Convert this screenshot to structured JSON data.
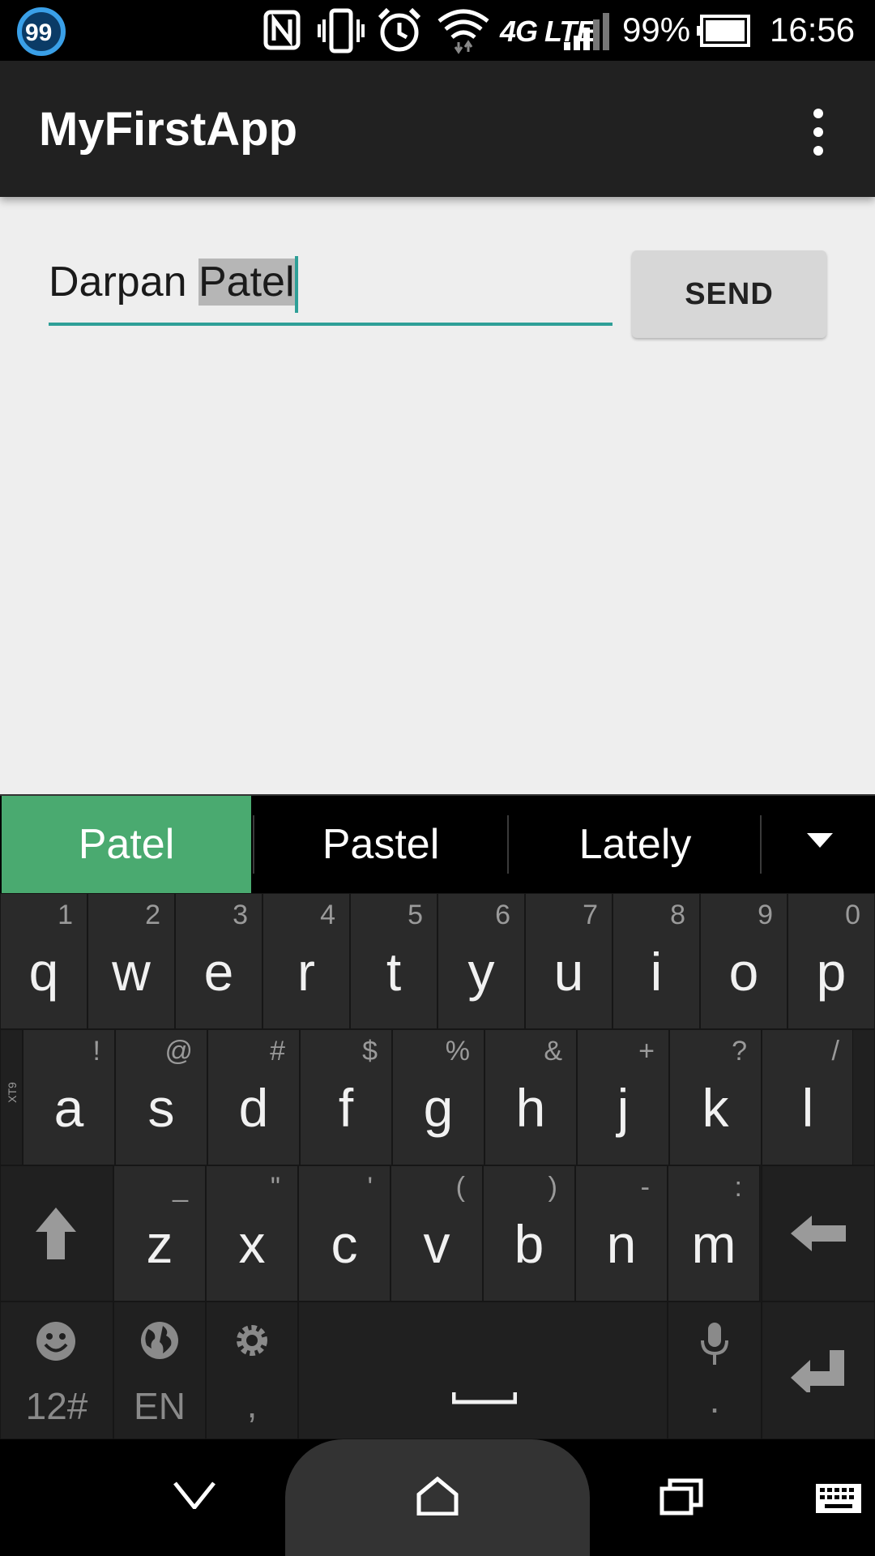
{
  "status_bar": {
    "badge": "99",
    "network": "4G LTE",
    "battery": "99%",
    "time": "16:56"
  },
  "app": {
    "title": "MyFirstApp"
  },
  "editor": {
    "text_before": "Darpan ",
    "text_selected": "Patel",
    "send_label": "SEND"
  },
  "suggestions": {
    "items": [
      "Patel",
      "Pastel",
      "Lately"
    ],
    "active_index": 0
  },
  "keyboard": {
    "row1": [
      {
        "key": "q",
        "hint": "1"
      },
      {
        "key": "w",
        "hint": "2"
      },
      {
        "key": "e",
        "hint": "3"
      },
      {
        "key": "r",
        "hint": "4"
      },
      {
        "key": "t",
        "hint": "5"
      },
      {
        "key": "y",
        "hint": "6"
      },
      {
        "key": "u",
        "hint": "7"
      },
      {
        "key": "i",
        "hint": "8"
      },
      {
        "key": "o",
        "hint": "9"
      },
      {
        "key": "p",
        "hint": "0"
      }
    ],
    "row2": [
      {
        "key": "a",
        "hint": "!"
      },
      {
        "key": "s",
        "hint": "@"
      },
      {
        "key": "d",
        "hint": "#"
      },
      {
        "key": "f",
        "hint": "$"
      },
      {
        "key": "g",
        "hint": "%"
      },
      {
        "key": "h",
        "hint": "&"
      },
      {
        "key": "j",
        "hint": "+"
      },
      {
        "key": "k",
        "hint": "?"
      },
      {
        "key": "l",
        "hint": "/"
      }
    ],
    "row3": [
      {
        "key": "z",
        "hint": "_"
      },
      {
        "key": "x",
        "hint": "\""
      },
      {
        "key": "c",
        "hint": "'"
      },
      {
        "key": "v",
        "hint": "("
      },
      {
        "key": "b",
        "hint": ")"
      },
      {
        "key": "n",
        "hint": "-"
      },
      {
        "key": "m",
        "hint": ":"
      }
    ],
    "side_label": "XT9",
    "symbols_label": "12#",
    "language_label": "EN",
    "settings_sub": ",",
    "mic_sub": "."
  },
  "colors": {
    "accent": "#2e9f97",
    "suggestion_active": "#4aaa70",
    "app_bar": "#212121"
  }
}
